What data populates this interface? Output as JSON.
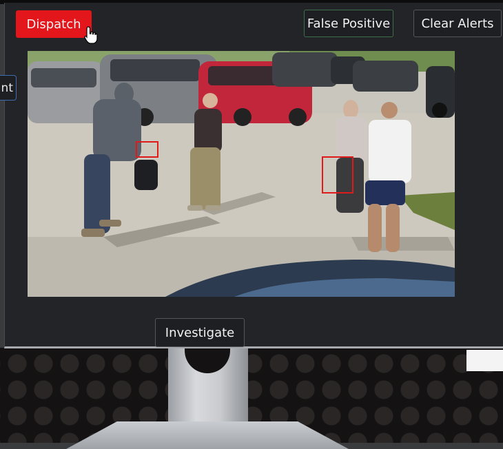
{
  "toolbar": {
    "dispatch_label": "Dispatch",
    "false_positive_label": "False Positive",
    "clear_alerts_label": "Clear Alerts"
  },
  "side_tab": {
    "label": "nt"
  },
  "footer": {
    "investigate_label": "Investigate"
  },
  "colors": {
    "dispatch": "#e3161b",
    "detection_box": "#e01a1a",
    "panel_bg": "#232427"
  },
  "icons": [
    "pointer-hand-cursor-icon"
  ]
}
